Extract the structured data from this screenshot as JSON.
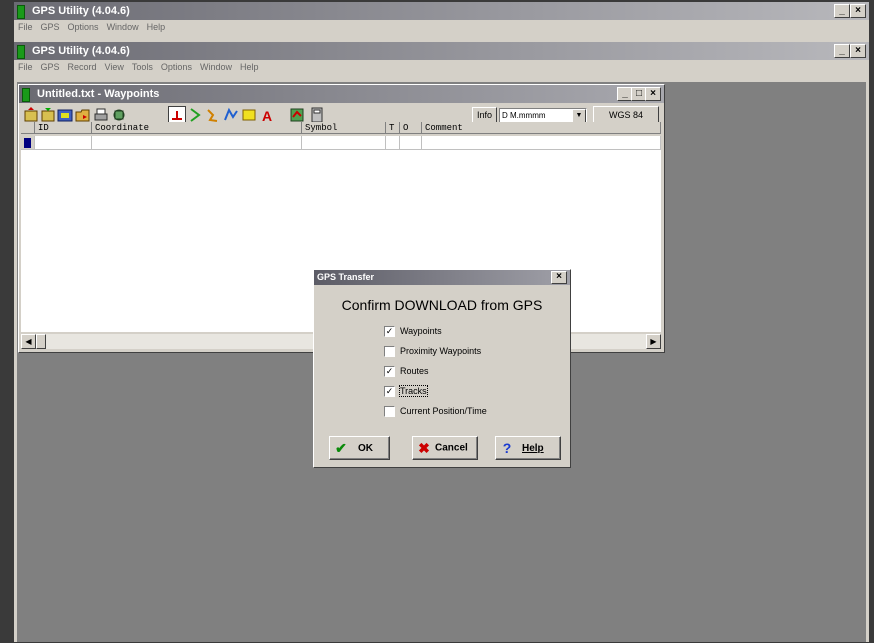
{
  "outer_window": {
    "title": "GPS Utility (4.04.6)",
    "menu": [
      "File",
      "GPS",
      "Options",
      "Window",
      "Help"
    ]
  },
  "app_window": {
    "title": "GPS Utility (4.04.6)",
    "menu": [
      "File",
      "GPS",
      "Record",
      "View",
      "Tools",
      "Options",
      "Window",
      "Help"
    ]
  },
  "waypoints_window": {
    "title": "Untitled.txt - Waypoints",
    "info_button": "Info",
    "format_value": "D M.mmmm",
    "datum_button": "WGS 84",
    "columns": [
      "ID",
      "Coordinate",
      "Symbol",
      "T",
      "O",
      "Comment"
    ]
  },
  "dialog": {
    "title": "GPS Transfer",
    "heading": "Confirm DOWNLOAD from GPS",
    "options": [
      {
        "label": "Waypoints",
        "checked": true
      },
      {
        "label": "Proximity Waypoints",
        "checked": false
      },
      {
        "label": "Routes",
        "checked": true
      },
      {
        "label": "Tracks",
        "checked": true
      },
      {
        "label": "Current Position/Time",
        "checked": false
      }
    ],
    "ok_label": "OK",
    "cancel_label": "Cancel",
    "help_label": "Help"
  },
  "colors": {
    "ok_check": "#0a8a0a",
    "cancel_x": "#cc0000",
    "help_q": "#1a3ad0"
  }
}
